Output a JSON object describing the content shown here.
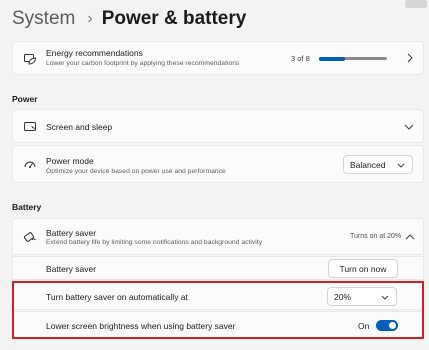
{
  "breadcrumb": {
    "parent": "System",
    "current": "Power & battery"
  },
  "energy": {
    "title": "Energy recommendations",
    "subtitle": "Lower your carbon footprint by applying these recommendations",
    "progress_text": "3 of 8",
    "progress_fraction": 0.375
  },
  "power_section": {
    "header": "Power",
    "screen_sleep": {
      "title": "Screen and sleep"
    },
    "power_mode": {
      "title": "Power mode",
      "subtitle": "Optimize your device based on power use and performance",
      "selected": "Balanced"
    }
  },
  "battery_section": {
    "header": "Battery",
    "saver": {
      "title": "Battery saver",
      "subtitle": "Extend battery life by limiting some notifications and background activity",
      "status": "Turns on at 20%"
    },
    "saver_row": {
      "label": "Battery saver",
      "button": "Turn on now"
    },
    "auto_row": {
      "label": "Turn battery saver on automatically at",
      "selected": "20%"
    },
    "brightness_row": {
      "label": "Lower screen brightness when using battery saver",
      "state": "On"
    }
  },
  "colors": {
    "accent": "#005fb8",
    "highlight_border": "#d21f26",
    "background": "#f3f3f3",
    "card": "#fbfbfb"
  },
  "icons": [
    "leaf-energy-icon",
    "screen-sleep-icon",
    "power-mode-icon",
    "battery-saver-icon",
    "chevron-right-icon",
    "chevron-down-icon",
    "chevron-up-icon"
  ]
}
